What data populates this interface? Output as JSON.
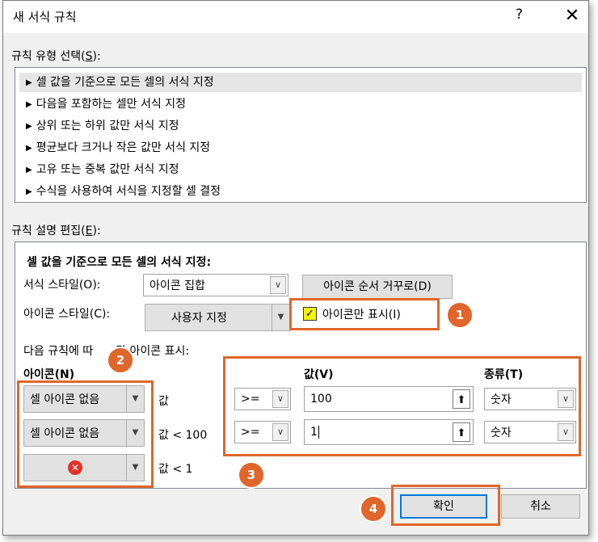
{
  "window": {
    "title": "새 서식 규칙",
    "help": "?",
    "close": "✕"
  },
  "rule_type": {
    "label_text": "규칙 유형 선택(",
    "label_key": "S",
    "label_end": "):",
    "items": [
      "셀 값을 기준으로 모든 셀의 서식 지정",
      "다음을 포함하는 셀만 서식 지정",
      "상위 또는 하위 값만 서식 지정",
      "평균보다 크거나 작은 값만 서식 지정",
      "고유 또는 중복 값만 서식 지정",
      "수식을 사용하여 서식을 지정할 셀 결정"
    ],
    "selected_index": 0
  },
  "edit": {
    "label_text": "규칙 설명 편집(",
    "label_key": "E",
    "label_end": "):",
    "heading": "셀 값을 기준으로 모든 셀의 서식 지정:",
    "format_style_label": "서식 스타일(O):",
    "format_style_value": "아이콘 집합",
    "reverse_button": "아이콘 순서 거꾸로(D)",
    "icon_style_label": "아이콘 스타일(C):",
    "icon_style_value": "사용자 지정",
    "icon_only_label": "아이콘만 표시(I)",
    "icon_only_checked": true,
    "rules_caption_a": "다음 규칙에 따",
    "rules_caption_b": "각 아이콘 표시:",
    "col_icon": "아이콘(N)",
    "col_value": "값(V)",
    "col_type": "종류(T)",
    "rows": [
      {
        "icon": "셀 아이콘 없음",
        "desc": "값",
        "op": ">=",
        "value": "100",
        "type": "숫자"
      },
      {
        "icon": "셀 아이콘 없음",
        "desc": "값 < 100",
        "op": ">=",
        "value": "1",
        "type": "숫자"
      },
      {
        "icon": "red-x",
        "desc": "값 < 1"
      }
    ]
  },
  "buttons": {
    "ok": "확인",
    "cancel": "취소"
  },
  "callouts": [
    "1",
    "2",
    "3",
    "4"
  ],
  "colors": {
    "callout": "#e0662b",
    "checkbox_highlight": "#f5f500",
    "red_x": "#e0332a"
  }
}
